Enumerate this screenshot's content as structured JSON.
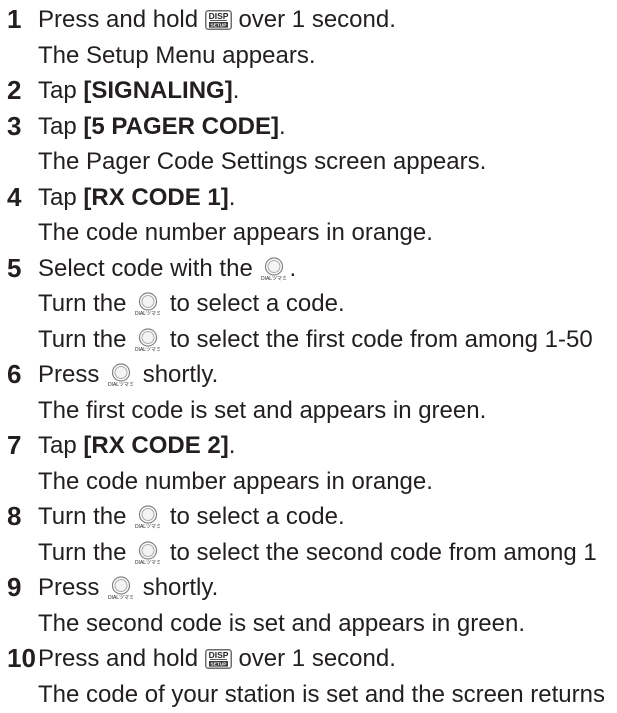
{
  "document": {
    "text_color": "#231f20"
  },
  "icons": {
    "disp_key": {
      "name": "disp-setup-key-icon",
      "top_label": "DISP",
      "bottom_label": "SETUP"
    },
    "dial": {
      "name": "dial-knob-icon",
      "caption": "DIALツマミ"
    }
  },
  "steps": [
    {
      "number": "1",
      "lines": [
        {
          "before": "Press and hold",
          "icon": "disp-setup-key-icon",
          "after": "over 1 second."
        },
        {
          "text": "The Setup Menu appears."
        }
      ]
    },
    {
      "number": "2",
      "lines": [
        {
          "before": "Tap",
          "bold": "[SIGNALING]",
          "after": "."
        }
      ]
    },
    {
      "number": "3",
      "lines": [
        {
          "before": "Tap",
          "bold": "[5 PAGER CODE]",
          "after": "."
        },
        {
          "text": "The Pager Code Settings screen appears."
        }
      ]
    },
    {
      "number": "4",
      "lines": [
        {
          "before": "Tap",
          "bold": "[RX CODE 1]",
          "after": "."
        },
        {
          "text": "The code number appears in orange."
        }
      ]
    },
    {
      "number": "5",
      "lines": [
        {
          "before": "Select code with the",
          "icon": "dial-knob-icon",
          "after": "."
        },
        {
          "before": "Turn the",
          "icon": "dial-knob-icon",
          "after": "to select a code."
        },
        {
          "before": "Turn the",
          "icon": "dial-knob-icon",
          "after": "to select the first code from among 1-50"
        }
      ]
    },
    {
      "number": "6",
      "lines": [
        {
          "before": "Press",
          "icon": "dial-knob-icon",
          "after": "shortly."
        },
        {
          "text": "The first code is set and appears in green."
        }
      ]
    },
    {
      "number": "7",
      "lines": [
        {
          "before": "Tap",
          "bold": "[RX CODE 2]",
          "after": "."
        },
        {
          "text": "The code number appears in orange."
        }
      ]
    },
    {
      "number": "8",
      "lines": [
        {
          "before": "Turn the",
          "icon": "dial-knob-icon",
          "after": "to select a code."
        },
        {
          "before": "Turn the",
          "icon": "dial-knob-icon",
          "after": "to select the second code from among 1"
        }
      ]
    },
    {
      "number": "9",
      "lines": [
        {
          "before": "Press",
          "icon": "dial-knob-icon",
          "after": "shortly."
        },
        {
          "text": "The second code is set and appears in green."
        }
      ]
    },
    {
      "number": "10",
      "lines": [
        {
          "before": "Press and hold",
          "icon": "disp-setup-key-icon",
          "after": "over 1 second."
        },
        {
          "text": "The code of your station is set and the screen returns"
        }
      ]
    }
  ]
}
